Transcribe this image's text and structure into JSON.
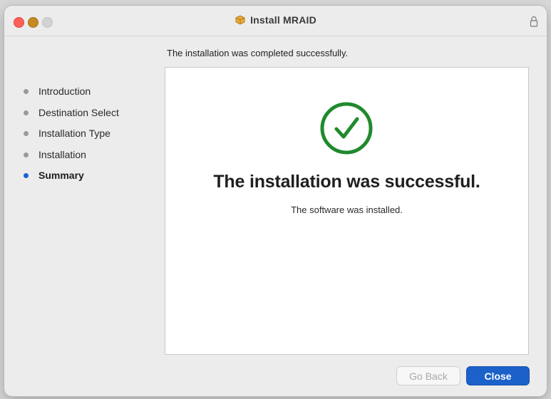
{
  "window": {
    "title": "Install MRAID"
  },
  "subtitle": "The installation was completed successfully.",
  "sidebar": {
    "steps": [
      {
        "label": "Introduction",
        "active": false
      },
      {
        "label": "Destination Select",
        "active": false
      },
      {
        "label": "Installation Type",
        "active": false
      },
      {
        "label": "Installation",
        "active": false
      },
      {
        "label": "Summary",
        "active": true
      }
    ]
  },
  "content": {
    "icon": "checkmark-circle-icon",
    "headline": "The installation was successful.",
    "detail": "The software was installed."
  },
  "buttons": {
    "back_label": "Go Back",
    "back_enabled": false,
    "close_label": "Close"
  },
  "colors": {
    "accent": "#1b61c9",
    "success": "#1f8a2e",
    "active_step_dot": "#1b5fd2"
  }
}
